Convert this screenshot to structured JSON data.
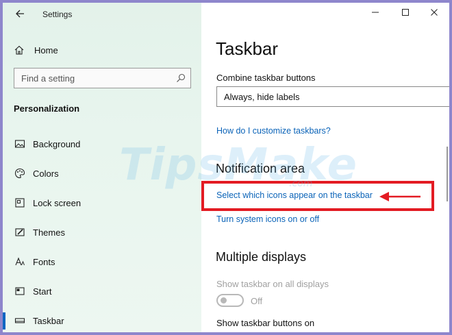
{
  "app": {
    "title": "Settings"
  },
  "sidebar": {
    "home_label": "Home",
    "search_placeholder": "Find a setting",
    "section_title": "Personalization",
    "items": [
      {
        "label": "Background",
        "icon": "picture-icon"
      },
      {
        "label": "Colors",
        "icon": "palette-icon"
      },
      {
        "label": "Lock screen",
        "icon": "lock-screen-icon"
      },
      {
        "label": "Themes",
        "icon": "brush-icon"
      },
      {
        "label": "Fonts",
        "icon": "font-icon"
      },
      {
        "label": "Start",
        "icon": "start-icon"
      },
      {
        "label": "Taskbar",
        "icon": "taskbar-icon",
        "active": true
      }
    ]
  },
  "main": {
    "title": "Taskbar",
    "combine_label": "Combine taskbar buttons",
    "combine_value": "Always, hide labels",
    "customize_link": "How do I customize taskbars?",
    "notification_heading": "Notification area",
    "select_icons_link": "Select which icons appear on the taskbar",
    "system_icons_link": "Turn system icons on or off",
    "multiple_displays_heading": "Multiple displays",
    "show_all_displays_label": "Show taskbar on all displays",
    "toggle_state": "Off",
    "show_buttons_on_label": "Show taskbar buttons on"
  },
  "watermark": {
    "text": "TipsMake",
    "suffix": ".com"
  },
  "colors": {
    "accent": "#0a66c2",
    "link": "#0a63b8",
    "highlight": "#e31b23",
    "frame": "#8e86cc"
  }
}
